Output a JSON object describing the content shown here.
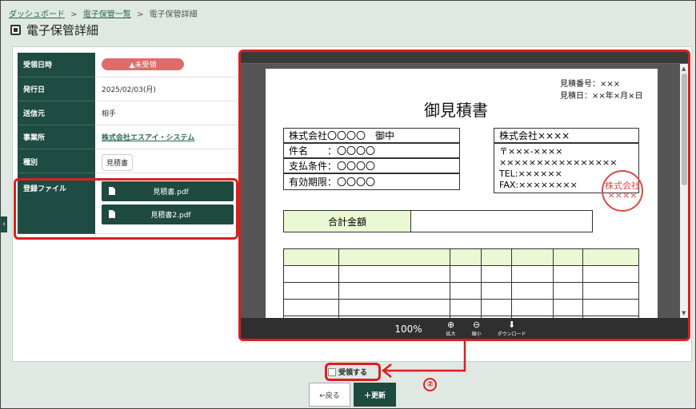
{
  "breadcrumb": {
    "items": [
      "ダッシュボード",
      "電子保管一覧",
      "電子保管詳細"
    ],
    "sep": ">"
  },
  "page": {
    "title": "電子保管詳細"
  },
  "info": {
    "received_label": "受領日時",
    "received_badge": "▲未受領",
    "issued_label": "発行日",
    "issued_value": "2025/02/03(月)",
    "sender_label": "送信元",
    "sender_value": "相手",
    "office_label": "事業所",
    "office_value": "株式会社エスアイ・システム",
    "type_label": "種別",
    "type_value": "見積書",
    "files_label": "登録ファイル",
    "files": [
      "見積書.pdf",
      "見積書2.pdf"
    ]
  },
  "document": {
    "number": "見積番号：×××",
    "date": "見積日：××年×月×日",
    "title": "御見積書",
    "client": "株式会社〇〇〇〇　御中",
    "subject": "件名　　：〇〇〇〇",
    "payment": "支払条件：〇〇〇〇",
    "validity": "有効期限：〇〇〇〇",
    "issuer": "株式会社××××",
    "postal": "〒×××-××××",
    "address": "××××××××××××××××",
    "tel": "TEL:××××××",
    "fax": "FAX:××××××××",
    "seal_line1": "株式会社",
    "seal_line2": "××××",
    "total_label": "合計金額"
  },
  "viewer": {
    "zoom": "100%",
    "zoom_in": "拡大",
    "zoom_out": "縮小",
    "download": "ダウンロード"
  },
  "footer": {
    "accept_label": "受領する",
    "back_label": "←戻る",
    "update_label": "＋更新",
    "step_marker": "②"
  },
  "colors": {
    "accent": "#1f4a40",
    "highlight": "#d82020",
    "badge": "#e06b6b"
  }
}
